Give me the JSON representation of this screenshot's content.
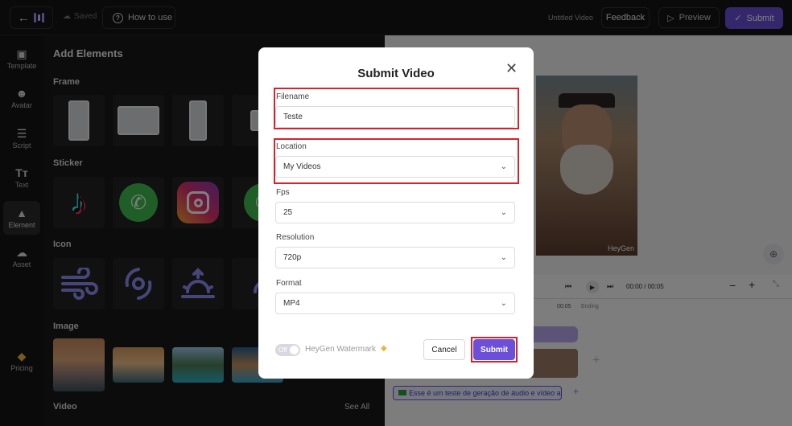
{
  "topbar": {
    "saved_label": "Saved",
    "how_to_label": "How to use",
    "video_title": "Untitled Video",
    "feedback_label": "Feedback",
    "preview_label": "Preview",
    "submit_label": "Submit"
  },
  "sidebar": {
    "items": [
      {
        "label": "Template",
        "icon": "template-icon"
      },
      {
        "label": "Avatar",
        "icon": "avatar-icon"
      },
      {
        "label": "Script",
        "icon": "script-icon"
      },
      {
        "label": "Text",
        "icon": "text-icon"
      },
      {
        "label": "Element",
        "icon": "element-icon",
        "active": true
      },
      {
        "label": "Asset",
        "icon": "asset-icon"
      }
    ],
    "pricing_label": "Pricing"
  },
  "panel": {
    "title": "Add Elements",
    "sections": [
      "Frame",
      "Sticker",
      "Icon",
      "Image",
      "Video"
    ],
    "see_all": "See All"
  },
  "editor": {
    "watermark": "HeyGen",
    "time_readout": "00:00 / 00:05",
    "ruler_mark": "00:05",
    "ending_label": "Ending",
    "script_text": "Esse é um teste de geração de áudio e vídeo a..."
  },
  "modal": {
    "title": "Submit Video",
    "filename_label": "Filename",
    "filename_value": "Teste",
    "location_label": "Location",
    "location_value": "My Videos",
    "fps_label": "Fps",
    "fps_value": "25",
    "resolution_label": "Resolution",
    "resolution_value": "720p",
    "format_label": "Format",
    "format_value": "MP4",
    "watermark_toggle_text": "Off",
    "watermark_label": "HeyGen Watermark",
    "cancel_label": "Cancel",
    "submit_label": "Submit"
  },
  "colors": {
    "accent": "#6b4fd8",
    "highlight": "#d7212b"
  }
}
